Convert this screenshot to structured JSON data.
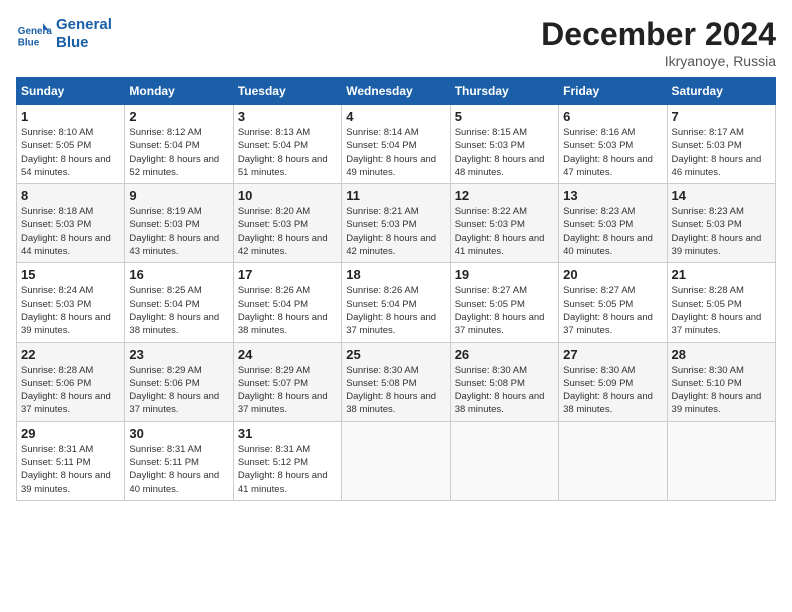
{
  "header": {
    "logo_general": "General",
    "logo_blue": "Blue",
    "month_title": "December 2024",
    "location": "Ikryanoye, Russia"
  },
  "weekdays": [
    "Sunday",
    "Monday",
    "Tuesday",
    "Wednesday",
    "Thursday",
    "Friday",
    "Saturday"
  ],
  "weeks": [
    [
      {
        "day": "1",
        "sunrise": "8:10 AM",
        "sunset": "5:05 PM",
        "daylight": "8 hours and 54 minutes."
      },
      {
        "day": "2",
        "sunrise": "8:12 AM",
        "sunset": "5:04 PM",
        "daylight": "8 hours and 52 minutes."
      },
      {
        "day": "3",
        "sunrise": "8:13 AM",
        "sunset": "5:04 PM",
        "daylight": "8 hours and 51 minutes."
      },
      {
        "day": "4",
        "sunrise": "8:14 AM",
        "sunset": "5:04 PM",
        "daylight": "8 hours and 49 minutes."
      },
      {
        "day": "5",
        "sunrise": "8:15 AM",
        "sunset": "5:03 PM",
        "daylight": "8 hours and 48 minutes."
      },
      {
        "day": "6",
        "sunrise": "8:16 AM",
        "sunset": "5:03 PM",
        "daylight": "8 hours and 47 minutes."
      },
      {
        "day": "7",
        "sunrise": "8:17 AM",
        "sunset": "5:03 PM",
        "daylight": "8 hours and 46 minutes."
      }
    ],
    [
      {
        "day": "8",
        "sunrise": "8:18 AM",
        "sunset": "5:03 PM",
        "daylight": "8 hours and 44 minutes."
      },
      {
        "day": "9",
        "sunrise": "8:19 AM",
        "sunset": "5:03 PM",
        "daylight": "8 hours and 43 minutes."
      },
      {
        "day": "10",
        "sunrise": "8:20 AM",
        "sunset": "5:03 PM",
        "daylight": "8 hours and 42 minutes."
      },
      {
        "day": "11",
        "sunrise": "8:21 AM",
        "sunset": "5:03 PM",
        "daylight": "8 hours and 42 minutes."
      },
      {
        "day": "12",
        "sunrise": "8:22 AM",
        "sunset": "5:03 PM",
        "daylight": "8 hours and 41 minutes."
      },
      {
        "day": "13",
        "sunrise": "8:23 AM",
        "sunset": "5:03 PM",
        "daylight": "8 hours and 40 minutes."
      },
      {
        "day": "14",
        "sunrise": "8:23 AM",
        "sunset": "5:03 PM",
        "daylight": "8 hours and 39 minutes."
      }
    ],
    [
      {
        "day": "15",
        "sunrise": "8:24 AM",
        "sunset": "5:03 PM",
        "daylight": "8 hours and 39 minutes."
      },
      {
        "day": "16",
        "sunrise": "8:25 AM",
        "sunset": "5:04 PM",
        "daylight": "8 hours and 38 minutes."
      },
      {
        "day": "17",
        "sunrise": "8:26 AM",
        "sunset": "5:04 PM",
        "daylight": "8 hours and 38 minutes."
      },
      {
        "day": "18",
        "sunrise": "8:26 AM",
        "sunset": "5:04 PM",
        "daylight": "8 hours and 37 minutes."
      },
      {
        "day": "19",
        "sunrise": "8:27 AM",
        "sunset": "5:05 PM",
        "daylight": "8 hours and 37 minutes."
      },
      {
        "day": "20",
        "sunrise": "8:27 AM",
        "sunset": "5:05 PM",
        "daylight": "8 hours and 37 minutes."
      },
      {
        "day": "21",
        "sunrise": "8:28 AM",
        "sunset": "5:05 PM",
        "daylight": "8 hours and 37 minutes."
      }
    ],
    [
      {
        "day": "22",
        "sunrise": "8:28 AM",
        "sunset": "5:06 PM",
        "daylight": "8 hours and 37 minutes."
      },
      {
        "day": "23",
        "sunrise": "8:29 AM",
        "sunset": "5:06 PM",
        "daylight": "8 hours and 37 minutes."
      },
      {
        "day": "24",
        "sunrise": "8:29 AM",
        "sunset": "5:07 PM",
        "daylight": "8 hours and 37 minutes."
      },
      {
        "day": "25",
        "sunrise": "8:30 AM",
        "sunset": "5:08 PM",
        "daylight": "8 hours and 38 minutes."
      },
      {
        "day": "26",
        "sunrise": "8:30 AM",
        "sunset": "5:08 PM",
        "daylight": "8 hours and 38 minutes."
      },
      {
        "day": "27",
        "sunrise": "8:30 AM",
        "sunset": "5:09 PM",
        "daylight": "8 hours and 38 minutes."
      },
      {
        "day": "28",
        "sunrise": "8:30 AM",
        "sunset": "5:10 PM",
        "daylight": "8 hours and 39 minutes."
      }
    ],
    [
      {
        "day": "29",
        "sunrise": "8:31 AM",
        "sunset": "5:11 PM",
        "daylight": "8 hours and 39 minutes."
      },
      {
        "day": "30",
        "sunrise": "8:31 AM",
        "sunset": "5:11 PM",
        "daylight": "8 hours and 40 minutes."
      },
      {
        "day": "31",
        "sunrise": "8:31 AM",
        "sunset": "5:12 PM",
        "daylight": "8 hours and 41 minutes."
      },
      null,
      null,
      null,
      null
    ]
  ]
}
